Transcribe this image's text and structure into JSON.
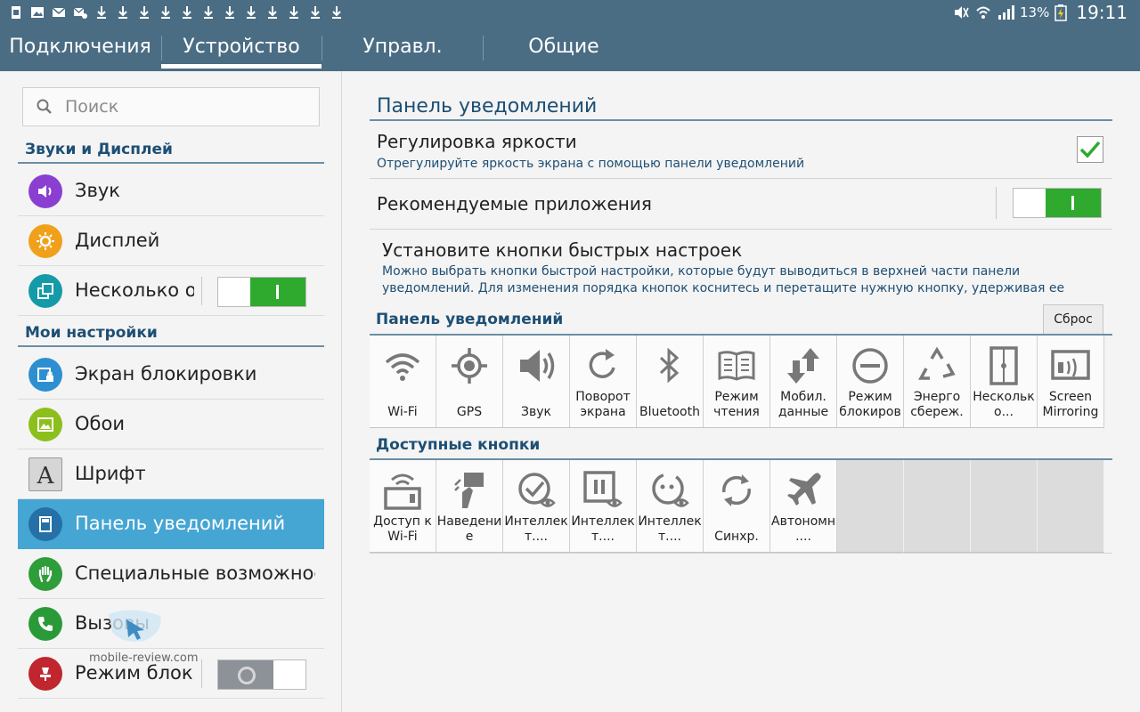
{
  "status_bar": {
    "battery": "13%",
    "time": "19:11"
  },
  "tabs": [
    {
      "label": "Подключения"
    },
    {
      "label": "Устройство"
    },
    {
      "label": "Управл."
    },
    {
      "label": "Общие"
    }
  ],
  "sidebar": {
    "search_placeholder": "Поиск",
    "section_sound_display": "Звуки и Дисплей",
    "section_my_settings": "Мои настройки",
    "items": [
      {
        "label": "Звук",
        "icon": "speaker-icon",
        "color": "#8a3fd1"
      },
      {
        "label": "Дисплей",
        "icon": "sun-icon",
        "color": "#f0a01a"
      },
      {
        "label": "Несколько окон",
        "icon": "multiwindow-icon",
        "color": "#159aa7",
        "toggle": "on"
      },
      {
        "label": "Экран блокировки",
        "icon": "lockscreen-icon",
        "color": "#2d8fd0"
      },
      {
        "label": "Обои",
        "icon": "wallpaper-icon",
        "color": "#8dbf1c"
      },
      {
        "label": "Шрифт",
        "icon": "font-icon",
        "color": "#8a8a8a"
      },
      {
        "label": "Панель уведомлений",
        "icon": "notification-panel-icon",
        "color": "#2570a6",
        "active": true
      },
      {
        "label": "Специальные возможности",
        "icon": "hand-icon",
        "color": "#2f9d3a"
      },
      {
        "label": "Вызовы",
        "icon": "phone-icon",
        "color": "#2a9a39"
      },
      {
        "label": "Режим блокировки",
        "icon": "block-mode-icon",
        "color": "#c0262e",
        "toggle": "off"
      }
    ],
    "watermark": "mobile-review.com"
  },
  "main": {
    "title": "Панель уведомлений",
    "brightness_title": "Регулировка яркости",
    "brightness_desc": "Отрегулируйте яркость экрана с помощью панели уведомлений",
    "recommended_title": "Рекомендуемые приложения",
    "quick_title": "Установите кнопки быстрых настроек",
    "quick_desc_1": "Можно выбрать кнопки быстрой настройки, которые будут выводиться в верхней части панели",
    "quick_desc_2": "уведомлений. Для изменения порядка кнопок коснитесь и перетащите нужную кнопку, удерживая ее",
    "panel_section": "Панель уведомлений",
    "reset_label": "Сброс",
    "available_section": "Доступные кнопки",
    "panel_buttons": [
      {
        "line1": "",
        "line2": "Wi-Fi",
        "icon": "wifi-icon"
      },
      {
        "line1": "",
        "line2": "GPS",
        "icon": "gps-icon"
      },
      {
        "line1": "",
        "line2": "Звук",
        "icon": "speaker-icon"
      },
      {
        "line1": "Поворот",
        "line2": "экрана",
        "icon": "rotate-icon"
      },
      {
        "line1": "",
        "line2": "Bluetooth",
        "icon": "bluetooth-icon"
      },
      {
        "line1": "Режим",
        "line2": "чтения",
        "icon": "book-icon"
      },
      {
        "line1": "Мобил.",
        "line2": "данные",
        "icon": "mobile-data-icon"
      },
      {
        "line1": "Режим",
        "line2": "блокиров",
        "icon": "block-icon"
      },
      {
        "line1": "Энерго",
        "line2": "сбереж.",
        "icon": "recycle-icon"
      },
      {
        "line1": "Нескольк",
        "line2": "о...",
        "icon": "multiwindow-icon"
      },
      {
        "line1": "Screen",
        "line2": "Mirroring",
        "icon": "screen-mirroring-icon"
      }
    ],
    "available_buttons": [
      {
        "line1": "Доступ к",
        "line2": "Wi-Fi",
        "icon": "wifi-hotspot-icon"
      },
      {
        "line1": "Наведени",
        "line2": "е",
        "icon": "air-view-icon"
      },
      {
        "line1": "Интеллек",
        "line2": "т....",
        "icon": "smart-stay-icon"
      },
      {
        "line1": "Интеллек",
        "line2": "т....",
        "icon": "smart-pause-icon"
      },
      {
        "line1": "Интеллек",
        "line2": "т....",
        "icon": "smart-rotation-icon"
      },
      {
        "line1": "",
        "line2": "Синхр.",
        "icon": "sync-icon"
      },
      {
        "line1": "Автономн",
        "line2": "....",
        "icon": "airplane-icon"
      }
    ]
  }
}
